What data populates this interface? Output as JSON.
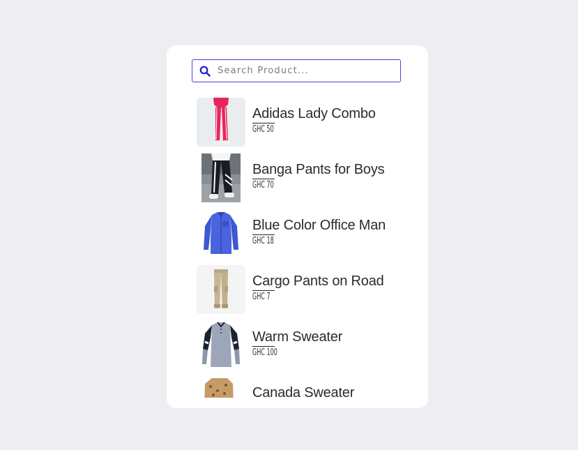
{
  "search": {
    "placeholder": "Search Product...",
    "icon": "search-icon",
    "accent_color": "#1a1ad8"
  },
  "products": [
    {
      "name": "Adidas Lady Combo",
      "price": "GHC 50"
    },
    {
      "name": "Banga Pants for Boys",
      "price": "GHC 70"
    },
    {
      "name": "Blue Color Office Man",
      "price": "GHC 18"
    },
    {
      "name": "Cargo Pants on Road",
      "price": "GHC 7"
    },
    {
      "name": "Warm Sweater",
      "price": "GHC 100"
    },
    {
      "name": "Canada Sweater",
      "price": ""
    }
  ]
}
